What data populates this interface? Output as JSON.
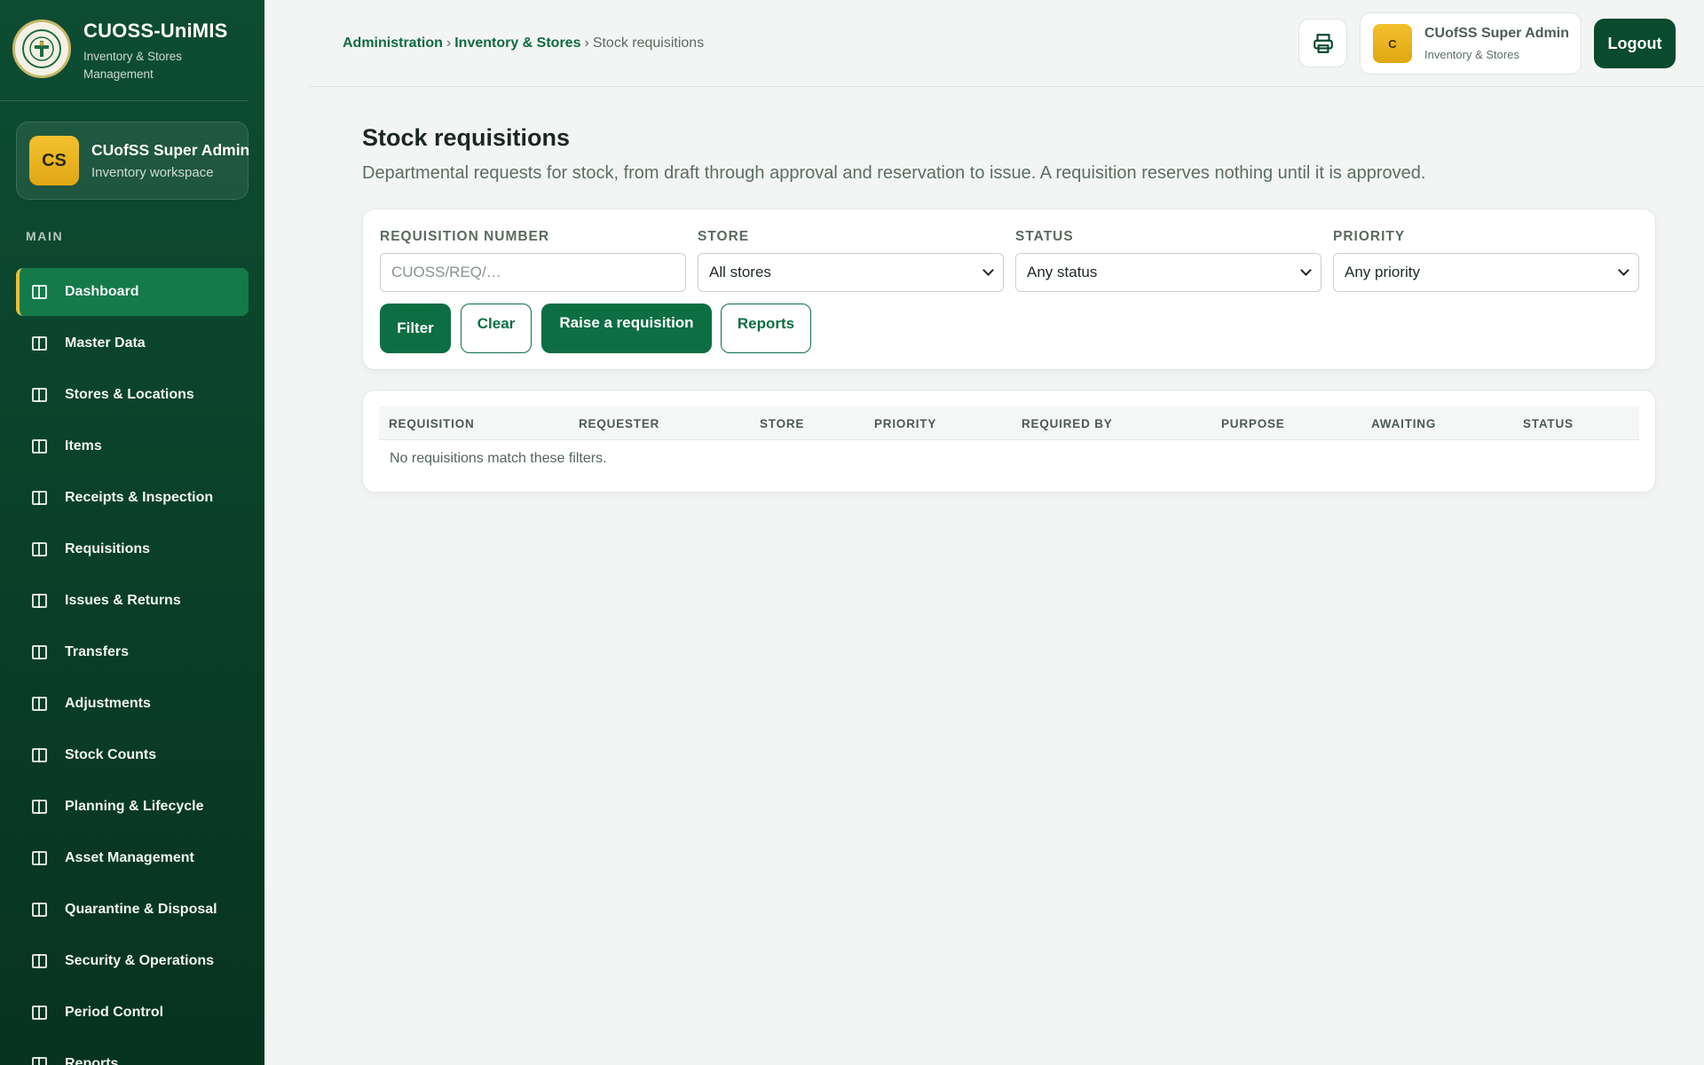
{
  "brand": {
    "title": "CUOSS-UniMIS",
    "subtitle": "Inventory & Stores Management"
  },
  "sidebar_user": {
    "initials": "CS",
    "name": "CUofSS Super Admin",
    "subtitle": "Inventory workspace"
  },
  "sidebar": {
    "section": "MAIN",
    "items": [
      {
        "label": "Dashboard",
        "active": true
      },
      {
        "label": "Master Data"
      },
      {
        "label": "Stores & Locations"
      },
      {
        "label": "Items"
      },
      {
        "label": "Receipts & Inspection"
      },
      {
        "label": "Requisitions"
      },
      {
        "label": "Issues & Returns"
      },
      {
        "label": "Transfers"
      },
      {
        "label": "Adjustments"
      },
      {
        "label": "Stock Counts"
      },
      {
        "label": "Planning & Lifecycle"
      },
      {
        "label": "Asset Management"
      },
      {
        "label": "Quarantine & Disposal"
      },
      {
        "label": "Security & Operations"
      },
      {
        "label": "Period Control"
      },
      {
        "label": "Reports"
      }
    ]
  },
  "breadcrumb": {
    "items": [
      "Administration",
      "Inventory & Stores"
    ],
    "separator": "›",
    "current": "Stock requisitions"
  },
  "top_user": {
    "initial": "C",
    "name": "CUofSS Super Admin",
    "subtitle": "Inventory & Stores"
  },
  "header": {
    "logout_label": "Logout",
    "print_icon": "printer-icon"
  },
  "page": {
    "title": "Stock requisitions",
    "description": "Departmental requests for stock, from draft through approval and reservation to issue. A requisition reserves nothing until it is approved."
  },
  "filters": {
    "requisition_number": {
      "label": "REQUISITION NUMBER",
      "placeholder": "CUOSS/REQ/…",
      "value": ""
    },
    "store": {
      "label": "STORE",
      "value": "All stores"
    },
    "status": {
      "label": "STATUS",
      "value": "Any status"
    },
    "priority": {
      "label": "PRIORITY",
      "value": "Any priority"
    },
    "buttons": {
      "filter": "Filter",
      "clear": "Clear",
      "raise": "Raise a requisition",
      "reports": "Reports"
    }
  },
  "table": {
    "columns": [
      "REQUISITION",
      "REQUESTER",
      "STORE",
      "PRIORITY",
      "REQUIRED BY",
      "PURPOSE",
      "AWAITING",
      "STATUS"
    ],
    "rows": [],
    "empty_message": "No requisitions match these filters."
  },
  "colors": {
    "sidebar": "#0a4029",
    "accent": "#0d6e42",
    "active_marker": "#e7bf3a",
    "avatar": "#e9b420"
  }
}
